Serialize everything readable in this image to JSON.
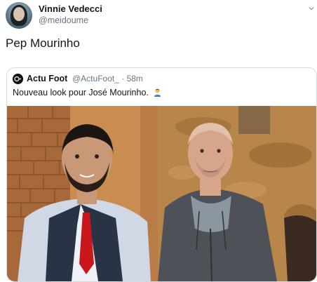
{
  "tweet": {
    "author": {
      "display_name": "Vinnie Vedecci",
      "handle": "@meidoume"
    },
    "text": "Pep Mourinho"
  },
  "quoted_tweet": {
    "author": {
      "display_name": "Actu Foot",
      "handle": "@ActuFoot_"
    },
    "separator": "·",
    "time": "58m",
    "text": "Nouveau look pour José Mourinho.",
    "emoji": "person-emoji"
  },
  "colors": {
    "primary_text": "#14171a",
    "secondary_text": "#657786",
    "border": "#d3dbe1",
    "link": "#1da1f2"
  },
  "icons": [
    "avatar",
    "chevron-down-icon",
    "actu-foot-logo",
    "person-emoji"
  ]
}
